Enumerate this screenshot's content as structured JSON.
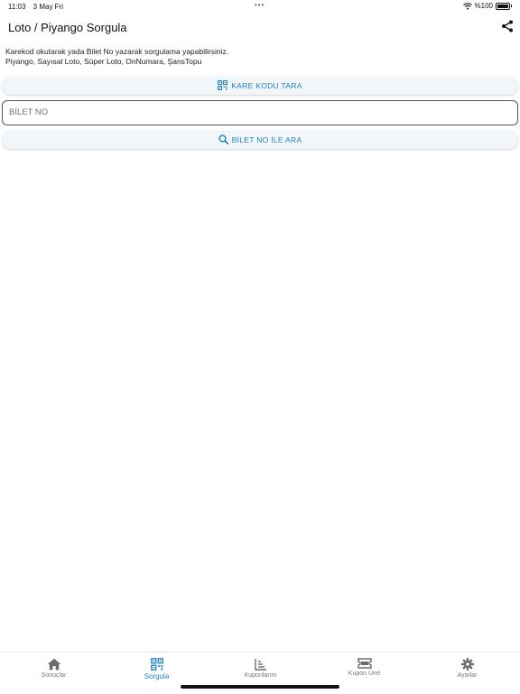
{
  "status": {
    "time": "11:03",
    "date": "3 May Fri",
    "battery": "%100"
  },
  "header": {
    "title": "Loto / Piyango Sorgula"
  },
  "info": {
    "line1": "Karekod okutarak yada Bilet No yazarak sorgulama yapabilirsiniz.",
    "line2": "Piyango, Sayısal Loto, Süper Loto, OnNumara, ŞansTopu"
  },
  "buttons": {
    "qr_label": "KARE KODU TARA",
    "search_label": "BİLET NO İLE ARA"
  },
  "ticket_input": {
    "placeholder": "BİLET NO"
  },
  "colors": {
    "accent": "#1d7fc4",
    "inactive": "#777777"
  },
  "tabs": [
    {
      "label": "Sonuçlar",
      "icon": "home-icon"
    },
    {
      "label": "Sorgula",
      "icon": "qr-icon"
    },
    {
      "label": "Kuponlarım",
      "icon": "chart-icon"
    },
    {
      "label": "Kupon Üret",
      "icon": "ticket-icon"
    },
    {
      "label": "Ayarlar",
      "icon": "gear-icon"
    }
  ],
  "active_tab": "Sorgula"
}
